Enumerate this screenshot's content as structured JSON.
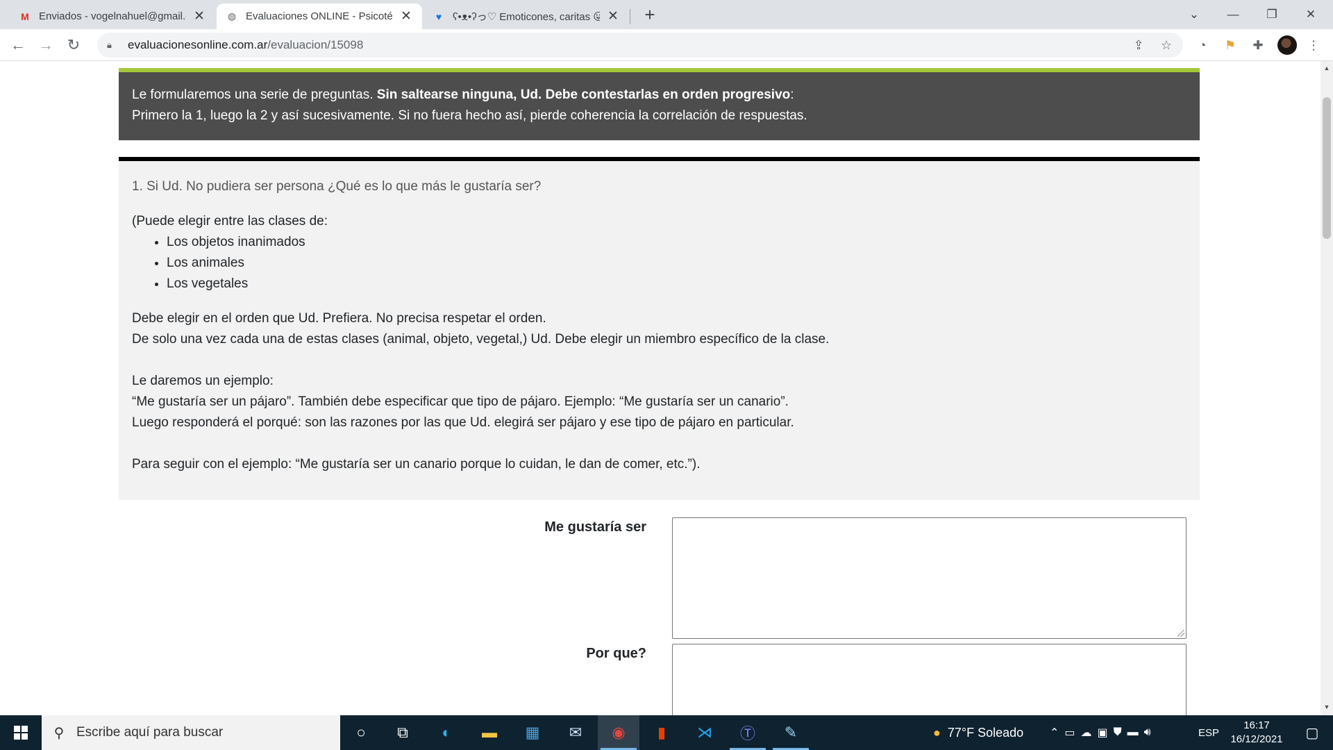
{
  "browser": {
    "tabs": [
      {
        "title": "Enviados - vogelnahuel@gmail.co",
        "favicon": "gmail-icon",
        "active": false
      },
      {
        "title": "Evaluaciones ONLINE - Psicotécn",
        "favicon": "globe-icon",
        "active": true
      },
      {
        "title": "ʕ•ᴥ•ʔっ♡ Emoticones, caritas 😛",
        "favicon": "heart-icon",
        "active": false
      }
    ],
    "url_host": "evaluacionesonline.com.ar",
    "url_path": "/evaluacion/15098"
  },
  "notice": {
    "line1_plain": "Le formularemos una serie de preguntas. ",
    "line1_bold": "Sin saltearse ninguna, Ud. Debe contestarlas en orden progresivo",
    "line1_end": ":",
    "line2": "Primero la 1, luego la 2 y así sucesivamente. Si no fuera hecho así, pierde coherencia la correlación de respuestas."
  },
  "question": {
    "title": "1. Si Ud. No pudiera ser persona ¿Qué es lo que más le gustaría ser?",
    "intro": "(Puede elegir entre las clases de:",
    "options": [
      "Los objetos inanimados",
      "Los animales",
      "Los vegetales"
    ],
    "para1_line1": "Debe elegir en el orden que Ud. Prefiera. No precisa respetar el orden.",
    "para1_line2": "De solo una vez cada una de estas clases (animal, objeto, vegetal,) Ud. Debe elegir un miembro específico de la clase.",
    "para2_line1": "Le daremos un ejemplo:",
    "para2_line2": "“Me gustaría ser un pájaro”. También debe especificar que tipo de pájaro. Ejemplo: “Me gustaría ser un canario”.",
    "para2_line3": "Luego responderá el porqué: son las razones por las que Ud. elegirá ser pájaro y ese tipo de pájaro en particular.",
    "para3": "Para seguir con el ejemplo: “Me gustaría ser un canario porque lo cuidan, le dan de comer, etc.”)."
  },
  "form": {
    "label_ser": "Me gustaría ser",
    "value_ser": "",
    "label_porque": "Por que?",
    "value_porque": ""
  },
  "taskbar": {
    "search_placeholder": "Escribe aquí para buscar",
    "weather": "77°F  Soleado",
    "language": "ESP",
    "time": "16:17",
    "date": "16/12/2021"
  },
  "colors": {
    "accent_green": "#a4c639",
    "notice_bg": "#4d4d4d",
    "question_bg": "#f2f2f2",
    "taskbar_bg": "#0f2230"
  }
}
